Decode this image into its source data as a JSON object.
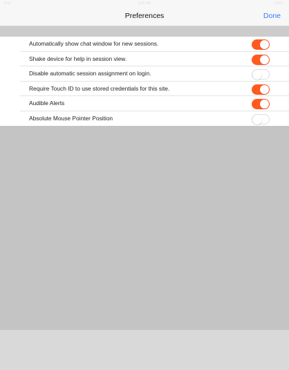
{
  "status_bar": {
    "carrier": "iPad",
    "time": "9:41 AM",
    "battery": "100%"
  },
  "navbar": {
    "title": "Preferences",
    "done_label": "Done"
  },
  "preferences": [
    {
      "label": "Automatically show chat window for new sessions.",
      "enabled": true
    },
    {
      "label": "Shake device for help in session view.",
      "enabled": true
    },
    {
      "label": "Disable automatic session assignment on login.",
      "enabled": false
    },
    {
      "label": "Require Touch ID to use stored credentials for this site.",
      "enabled": true
    },
    {
      "label": "Audible Alerts",
      "enabled": true
    },
    {
      "label": "Absolute Mouse Pointer Position",
      "enabled": false
    }
  ],
  "colors": {
    "accent": "#ff5a1f",
    "link": "#2f7cf6",
    "background": "#c9c9c9",
    "list_background": "#ffffff",
    "navbar_background": "#f7f7f7"
  }
}
